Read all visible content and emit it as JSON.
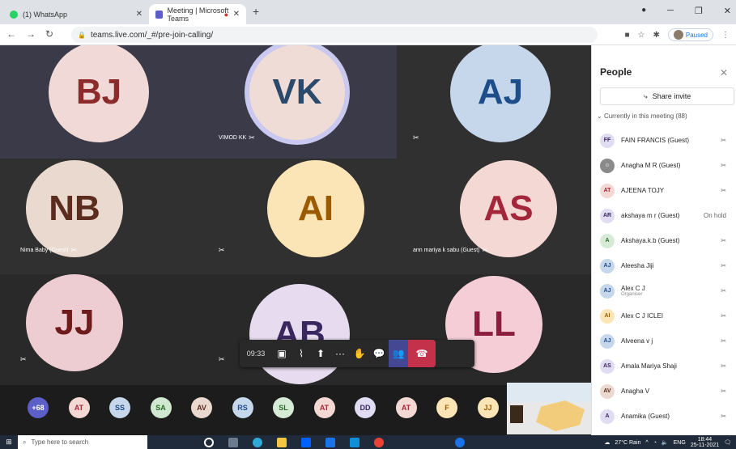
{
  "browser": {
    "tabs": [
      {
        "label": "(1) WhatsApp",
        "color": "#25d366"
      },
      {
        "label": "Meeting | Microsoft Teams",
        "color": "#5b5fc7"
      }
    ],
    "new_tab": "+",
    "url": "teams.live.com/_#/pre-join-calling/",
    "paused": "Paused"
  },
  "stage": {
    "tiles": [
      {
        "initials": "BJ",
        "bg": "#3a3a48",
        "circle": "#f0d9d6",
        "fg": "#8b2b2b",
        "name": ""
      },
      {
        "initials": "VK",
        "bg": "#3a3a48",
        "circle": "#f0dcd6",
        "fg": "#2b4a6b",
        "name": "VIMOD KK"
      },
      {
        "initials": "AJ",
        "bg": "#303030",
        "circle": "#c6d7ec",
        "fg": "#1d4e89",
        "name": ""
      },
      {
        "initials": "NB",
        "bg": "#303030",
        "circle": "#ead9cf",
        "fg": "#5c2c1e",
        "name": "Nima Baby (Guest)"
      },
      {
        "initials": "AI",
        "bg": "#303030",
        "circle": "#fbe5b6",
        "fg": "#9b5a00",
        "name": ""
      },
      {
        "initials": "AS",
        "bg": "#303030",
        "circle": "#f4d8d4",
        "fg": "#a3273a",
        "name": "ann mariya k sabu (Guest)"
      },
      {
        "initials": "JJ",
        "bg": "#292929",
        "circle": "#eecdd2",
        "fg": "#6e1b1b",
        "name": ""
      },
      {
        "initials": "AB",
        "bg": "#292929",
        "circle": "#e7dcef",
        "fg": "#3b2760",
        "name": ""
      },
      {
        "initials": "LL",
        "bg": "#292929",
        "circle": "#f4cdd6",
        "fg": "#8b1e3f",
        "name": ""
      }
    ]
  },
  "controls": {
    "time": "09:33"
  },
  "strip": [
    {
      "t": "+68",
      "bg": "#5b5fc7",
      "fg": "#fff"
    },
    {
      "t": "AT",
      "bg": "#f4d8d4",
      "fg": "#a3273a"
    },
    {
      "t": "SS",
      "bg": "#c6d7ec",
      "fg": "#1d4e89"
    },
    {
      "t": "SA",
      "bg": "#cfe8cf",
      "fg": "#2b6b2b"
    },
    {
      "t": "AV",
      "bg": "#ead9cf",
      "fg": "#5c2c1e"
    },
    {
      "t": "RS",
      "bg": "#c6d7ec",
      "fg": "#1d4e89"
    },
    {
      "t": "SL",
      "bg": "#d6ebd6",
      "fg": "#2b6b2b"
    },
    {
      "t": "AT",
      "bg": "#f4d8d4",
      "fg": "#a3273a"
    },
    {
      "t": "DD",
      "bg": "#e0ddf2",
      "fg": "#3b2760"
    },
    {
      "t": "AT",
      "bg": "#f4d8d4",
      "fg": "#a3273a"
    },
    {
      "t": "F",
      "bg": "#fbe5b6",
      "fg": "#9b5a00"
    },
    {
      "t": "JJ",
      "bg": "#fbe5b6",
      "fg": "#9b5a00"
    }
  ],
  "people": {
    "title": "People",
    "share": "Share invite",
    "current": "Currently in this meeting (88)",
    "list": [
      {
        "i": "FF",
        "n": "FAIN FRANCIS (Guest)",
        "s": "",
        "r": "mic",
        "bg": "#e0ddf2",
        "fg": "#3b2760"
      },
      {
        "i": "",
        "n": "Anagha M R (Guest)",
        "s": "",
        "r": "mic",
        "bg": "#8a8a8a",
        "fg": "#fff"
      },
      {
        "i": "AT",
        "n": "AJEENA TOJY",
        "s": "",
        "r": "mic",
        "bg": "#f4d8d4",
        "fg": "#a3273a"
      },
      {
        "i": "AR",
        "n": "akshaya m r (Guest)",
        "s": "",
        "r": "On hold",
        "bg": "#e0ddf2",
        "fg": "#3b2760"
      },
      {
        "i": "A",
        "n": "Akshaya.k.b (Guest)",
        "s": "",
        "r": "mic",
        "bg": "#d6ebd6",
        "fg": "#2b6b2b"
      },
      {
        "i": "AJ",
        "n": "Aleesha Jiji",
        "s": "",
        "r": "mic",
        "bg": "#c6d7ec",
        "fg": "#1d4e89"
      },
      {
        "i": "AJ",
        "n": "Alex C J",
        "s": "Organiser",
        "r": "mic",
        "bg": "#c6d7ec",
        "fg": "#1d4e89"
      },
      {
        "i": "AI",
        "n": "Alex C J ICLEI",
        "s": "",
        "r": "mic",
        "bg": "#fbe5b6",
        "fg": "#9b5a00"
      },
      {
        "i": "AJ",
        "n": "Alveena v j",
        "s": "",
        "r": "mic",
        "bg": "#c6d7ec",
        "fg": "#1d4e89"
      },
      {
        "i": "AS",
        "n": "Amala Mariya Shaji",
        "s": "",
        "r": "mic",
        "bg": "#e0ddf2",
        "fg": "#3b2760"
      },
      {
        "i": "AV",
        "n": "Anagha V",
        "s": "",
        "r": "mic",
        "bg": "#ead9cf",
        "fg": "#5c2c1e"
      },
      {
        "i": "A",
        "n": "Anamika (Guest)",
        "s": "",
        "r": "mic",
        "bg": "#e0ddf2",
        "fg": "#3b2760"
      }
    ]
  },
  "taskbar": {
    "search": "Type here to search",
    "weather": "27°C Rain",
    "lang": "ENG",
    "time": "18:44",
    "date": "25-11-2021"
  }
}
